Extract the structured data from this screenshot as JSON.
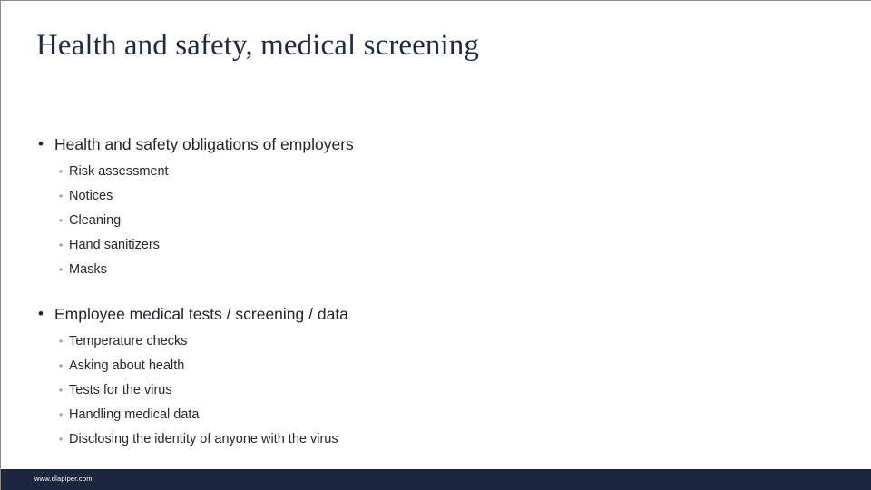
{
  "slide": {
    "title": "Health and safety, medical screening",
    "bullet_char": "•",
    "sub_bullet_char": "•",
    "groups": [
      {
        "heading": "Health and safety obligations of employers",
        "items": [
          "Risk assessment",
          "Notices",
          "Cleaning",
          "Hand sanitizers",
          "Masks"
        ]
      },
      {
        "heading": "Employee medical tests / screening / data",
        "items": [
          "Temperature checks",
          "Asking about health",
          "Tests for the virus",
          "Handling medical data",
          "Disclosing the identity of anyone with the virus"
        ]
      }
    ]
  },
  "footer": {
    "url": "www.dlapiper.com"
  },
  "colors": {
    "title": "#1f2a44",
    "body_text": "#24282f",
    "footer_bar": "#1c2540",
    "footer_text": "#ffffff",
    "sub_bullet_marker": "#9aa0a8",
    "slide_background": "#ffffff"
  }
}
